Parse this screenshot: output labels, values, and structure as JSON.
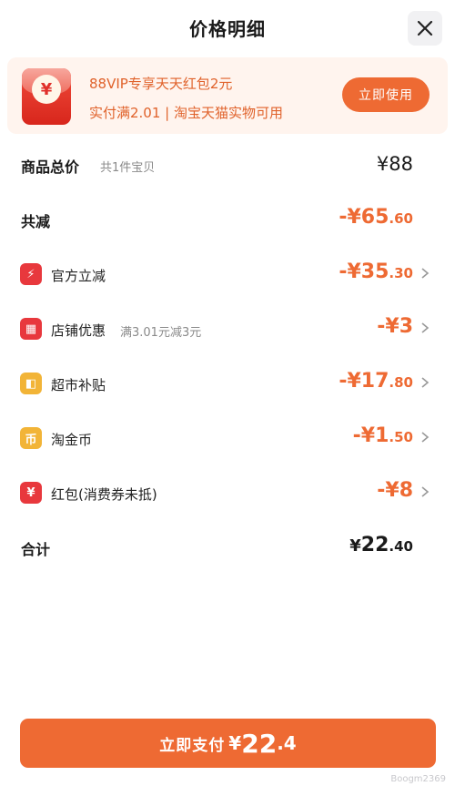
{
  "header": {
    "title": "价格明细"
  },
  "promo": {
    "coin_symbol": "¥",
    "line1": "88VIP专享天天红包2元",
    "line2": "实付满2.01 | 淘宝天猫实物可用",
    "button_label": "立即使用"
  },
  "summary": {
    "total_label": "商品总价",
    "total_sub": "共1件宝贝",
    "total_amount": "¥88",
    "discount_label": "共减",
    "discount_prefix": "-¥",
    "discount_int": "65",
    "discount_dec": ".60"
  },
  "items": [
    {
      "label": "官方立减",
      "sub": "",
      "prefix": "-¥",
      "int": "35",
      "dec": ".30",
      "icon": "lightning-icon",
      "icon_glyph": "⚡",
      "color": "#e8383d"
    },
    {
      "label": "店铺优惠",
      "sub": "满3.01元减3元",
      "prefix": "-¥",
      "int": "3",
      "dec": "",
      "icon": "shop-icon",
      "icon_glyph": "▦",
      "color": "#e8383d"
    },
    {
      "label": "超市补贴",
      "sub": "",
      "prefix": "-¥",
      "int": "17",
      "dec": ".80",
      "icon": "shopping-bag-icon",
      "icon_glyph": "◧",
      "color": "#f2b437"
    },
    {
      "label": "淘金币",
      "sub": "",
      "prefix": "-¥",
      "int": "1",
      "dec": ".50",
      "icon": "coin-icon",
      "icon_glyph": "币",
      "color": "#f2b437"
    },
    {
      "label": "红包(消费券未抵)",
      "sub": "",
      "prefix": "-¥",
      "int": "8",
      "dec": "",
      "icon": "red-packet-icon",
      "icon_glyph": "¥",
      "color": "#e8383d"
    }
  ],
  "total": {
    "label": "合计",
    "prefix": "¥",
    "int": "22",
    "dec": ".40"
  },
  "pay": {
    "label": "立即支付",
    "currency": "¥",
    "int": "22",
    "dec": ".4"
  },
  "watermark": "Boogm2369"
}
